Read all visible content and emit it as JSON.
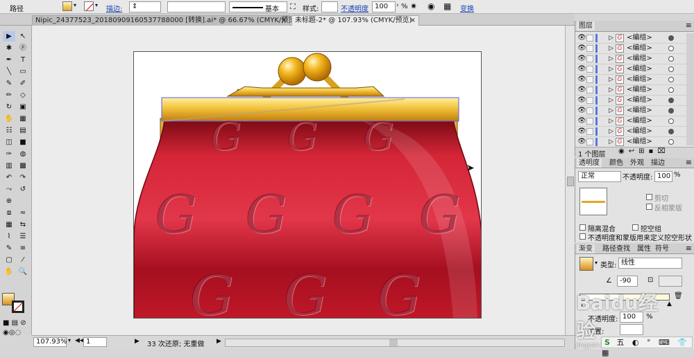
{
  "control_bar": {
    "object_type": "路径",
    "stroke_label": "描边:",
    "stroke_style": "基本",
    "style_label": "样式:",
    "opacity_label": "不透明度",
    "opacity_value": "100",
    "opacity_unit": "%",
    "transform_label": "变换"
  },
  "tabs": [
    {
      "label": "Nipic_24377523_20180909160537788000 [转换].ai* @ 66.67% (CMYK/预览)",
      "close": "×",
      "active": false
    },
    {
      "label": "未标题-2* @ 107.93% (CMYK/预览)",
      "close": "×",
      "active": true
    }
  ],
  "tools": [
    [
      "▶",
      "↖"
    ],
    [
      "✱",
      "ⓟ"
    ],
    [
      "✒",
      "T"
    ],
    [
      "╲",
      "▭"
    ],
    [
      "✎",
      "✐"
    ],
    [
      "✏",
      "◇"
    ],
    [
      "↻",
      "▣"
    ],
    [
      "✋",
      "▦"
    ],
    [
      "☷",
      "▤"
    ],
    [
      "◫",
      "■"
    ],
    [
      "✑",
      "◍"
    ],
    [
      "▥",
      "▩"
    ],
    [
      "↶",
      "↷"
    ],
    [
      "⤳",
      "↺"
    ],
    [
      "⊕",
      ""
    ],
    [
      "⧈",
      "≈"
    ],
    [
      "▦",
      "⇆"
    ],
    [
      "⌇",
      "☰"
    ],
    [
      "✎",
      "≡"
    ],
    [
      "▢",
      "⁄"
    ],
    [
      "✋",
      "🔍"
    ]
  ],
  "layers": {
    "title": "图层",
    "items": [
      {
        "name": "<编组>",
        "filled": true
      },
      {
        "name": "<编组>",
        "filled": false
      },
      {
        "name": "<编组>",
        "filled": false
      },
      {
        "name": "<编组>",
        "filled": false
      },
      {
        "name": "<编组>",
        "filled": false
      },
      {
        "name": "<编组>",
        "filled": false
      },
      {
        "name": "<编组>",
        "filled": true
      },
      {
        "name": "<编组>",
        "filled": true
      },
      {
        "name": "<编组>",
        "filled": false
      },
      {
        "name": "<编组>",
        "filled": true
      },
      {
        "name": "<编组>",
        "filled": false
      }
    ],
    "footer": "1 个图层"
  },
  "transparency_panel": {
    "tabs": [
      "透明度",
      "颜色",
      "外观",
      "描边"
    ],
    "blend_mode": "正常",
    "opacity_label": "不透明度:",
    "opacity_value": "100",
    "opacity_unit": "%",
    "clip_label": "剪切",
    "invert_label": "反相蒙版",
    "isolate_label": "隔离混合",
    "knockout_label": "挖空组",
    "opacity_mask_label": "不透明度和蒙版用来定义挖空形状"
  },
  "gradient_panel": {
    "tabs": [
      "渐变",
      "路径查找",
      "属性",
      "符号"
    ],
    "type_label": "类型:",
    "type_value": "线性",
    "angle_value": "-90",
    "opacity_label": "不透明度:",
    "opacity_value": "100",
    "opacity_unit": "%",
    "position_label": "位置:"
  },
  "status_bar": {
    "zoom": "107.93%",
    "page": "1",
    "history": "33 次还原; 无重做"
  },
  "artwork": {
    "g_marks": [
      "G",
      "G",
      "G",
      "G",
      "G",
      "G",
      "G",
      "G",
      "G",
      "G"
    ]
  },
  "watermark": "Baidu经验",
  "watermark_sub": "jingyan.baidu.com",
  "colors": {
    "gold": "#e3a821",
    "red": "#c8192a",
    "ui": "#d6d6d6"
  }
}
